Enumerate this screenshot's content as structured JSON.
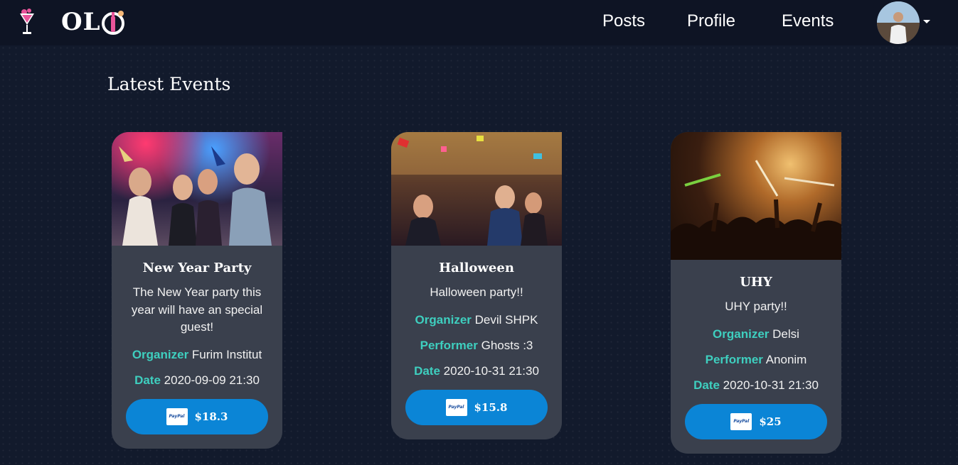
{
  "brand": {
    "logo_text": "OL"
  },
  "nav": {
    "links": [
      {
        "label": "Posts"
      },
      {
        "label": "Profile"
      },
      {
        "label": "Events"
      }
    ]
  },
  "section_title": "Latest Events",
  "labels": {
    "organizer": "Organizer",
    "performer": "Performer",
    "date": "Date",
    "paypal": "PayPal"
  },
  "events": [
    {
      "title": "New Year Party",
      "description": "The New Year party this year will have an special guest!",
      "organizer": "Furim Institut",
      "date": "2020-09-09 21:30",
      "price": "$18.3"
    },
    {
      "title": "Halloween",
      "description": "Halloween party!!",
      "organizer": "Devil SHPK",
      "performer": "Ghosts :3",
      "date": "2020-10-31 21:30",
      "price": "$15.8"
    },
    {
      "title": "UHY",
      "description": "UHY party!!",
      "organizer": "Delsi",
      "performer": "Anonim",
      "date": "2020-10-31 21:30",
      "price": "$25"
    }
  ],
  "colors": {
    "accent": "#3ecfbf",
    "button": "#0b85d6",
    "card": "#3a404d",
    "background": "#121a2c"
  }
}
